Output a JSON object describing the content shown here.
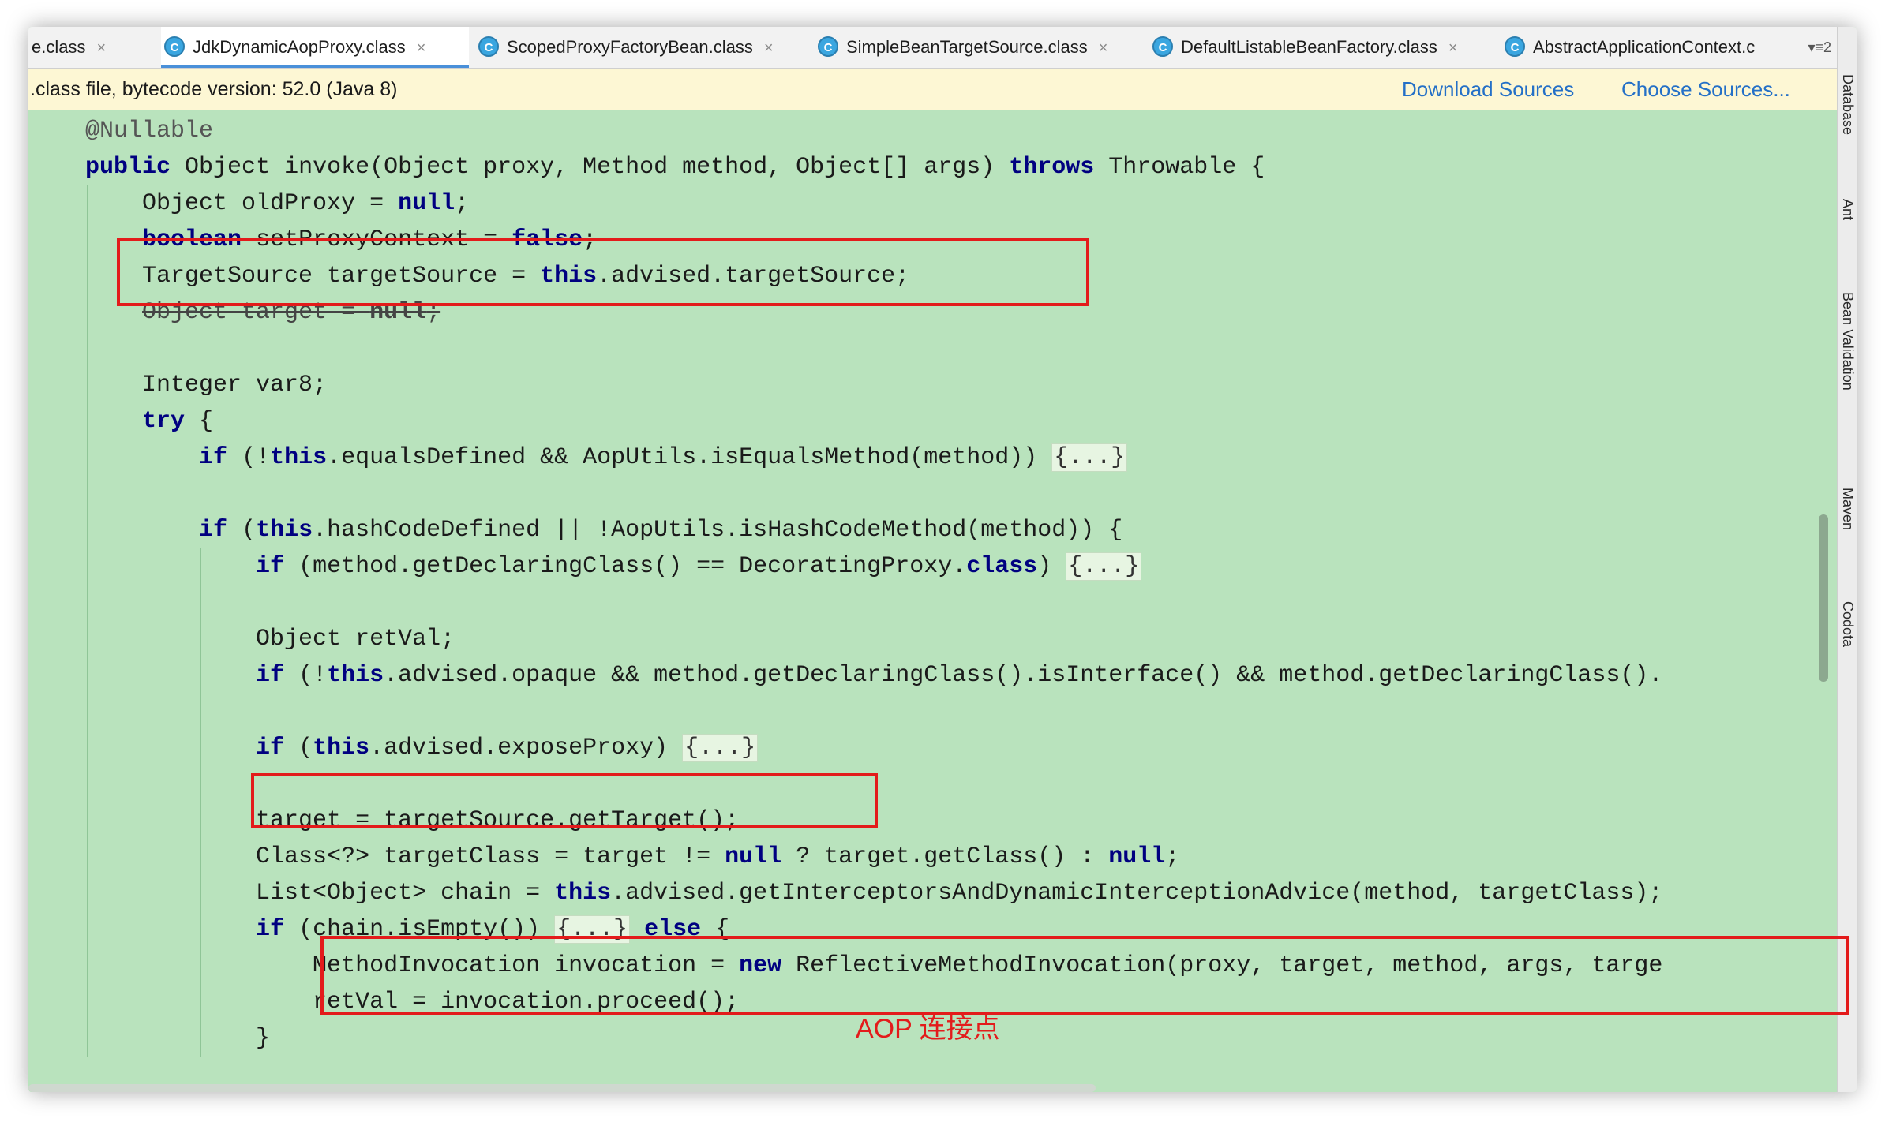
{
  "tabs": [
    {
      "label": "e.class",
      "active": false,
      "icon": false
    },
    {
      "label": "JdkDynamicAopProxy.class",
      "active": true,
      "icon": true
    },
    {
      "label": "ScopedProxyFactoryBean.class",
      "active": false,
      "icon": true
    },
    {
      "label": "SimpleBeanTargetSource.class",
      "active": false,
      "icon": true
    },
    {
      "label": "DefaultListableBeanFactory.class",
      "active": false,
      "icon": true
    },
    {
      "label": "AbstractApplicationContext.c",
      "active": false,
      "icon": true
    }
  ],
  "tab_icon_letter": "C",
  "tab_close_glyph": "×",
  "tab_overflow": "▾≡2",
  "notice": {
    "text": ".class file, bytecode version: 52.0 (Java 8)",
    "download_sources": "Download Sources",
    "choose_sources": "Choose Sources..."
  },
  "tool_windows": [
    "Database",
    "Ant",
    "Bean Validation",
    "Maven",
    "Codota"
  ],
  "code_lines": [
    [
      {
        "t": "    "
      },
      {
        "t": "@Nullable",
        "c": "ann"
      }
    ],
    [
      {
        "t": "    "
      },
      {
        "t": "public",
        "c": "kw"
      },
      {
        "t": " Object invoke(Object proxy, Method method, Object[] args) "
      },
      {
        "t": "throws",
        "c": "kw"
      },
      {
        "t": " Throwable {"
      }
    ],
    [
      {
        "t": "        Object oldProxy = "
      },
      {
        "t": "null",
        "c": "kw"
      },
      {
        "t": ";"
      }
    ],
    [
      {
        "t": "        "
      },
      {
        "t": "boolean",
        "c": "kw"
      },
      {
        "t": " setProxyContext = "
      },
      {
        "t": "false",
        "c": "kw"
      },
      {
        "t": ";"
      }
    ],
    [
      {
        "t": "        TargetSource targetSource = "
      },
      {
        "t": "this",
        "c": "kw"
      },
      {
        "t": ".advised.targetSource;"
      }
    ],
    [
      {
        "t": "        "
      },
      {
        "t": "Object target = ",
        "c": "strike"
      },
      {
        "t": "null",
        "c": "kw strike"
      },
      {
        "t": ";",
        "c": "strike"
      }
    ],
    [],
    [
      {
        "t": "        Integer var8;"
      }
    ],
    [
      {
        "t": "        "
      },
      {
        "t": "try",
        "c": "kw"
      },
      {
        "t": " {"
      }
    ],
    [
      {
        "t": "            "
      },
      {
        "t": "if",
        "c": "kw"
      },
      {
        "t": " (!"
      },
      {
        "t": "this",
        "c": "kw"
      },
      {
        "t": ".equalsDefined && AopUtils.isEqualsMethod(method)) "
      },
      {
        "t": "{...}",
        "c": "fold"
      }
    ],
    [],
    [
      {
        "t": "            "
      },
      {
        "t": "if",
        "c": "kw"
      },
      {
        "t": " ("
      },
      {
        "t": "this",
        "c": "kw"
      },
      {
        "t": ".hashCodeDefined || !AopUtils.isHashCodeMethod(method)) {"
      }
    ],
    [
      {
        "t": "                "
      },
      {
        "t": "if",
        "c": "kw"
      },
      {
        "t": " (method.getDeclaringClass() == DecoratingProxy."
      },
      {
        "t": "class",
        "c": "kw"
      },
      {
        "t": ") "
      },
      {
        "t": "{...}",
        "c": "fold"
      }
    ],
    [],
    [
      {
        "t": "                Object retVal;"
      }
    ],
    [
      {
        "t": "                "
      },
      {
        "t": "if",
        "c": "kw"
      },
      {
        "t": " (!"
      },
      {
        "t": "this",
        "c": "kw"
      },
      {
        "t": ".advised.opaque && method.getDeclaringClass().isInterface() && method.getDeclaringClass()."
      }
    ],
    [],
    [
      {
        "t": "                "
      },
      {
        "t": "if",
        "c": "kw"
      },
      {
        "t": " ("
      },
      {
        "t": "this",
        "c": "kw"
      },
      {
        "t": ".advised.exposeProxy) "
      },
      {
        "t": "{...}",
        "c": "fold"
      }
    ],
    [],
    [
      {
        "t": "                target = targetSource.getTarget();"
      }
    ],
    [
      {
        "t": "                Class<?> targetClass = target != "
      },
      {
        "t": "null",
        "c": "kw"
      },
      {
        "t": " ? target.getClass() : "
      },
      {
        "t": "null",
        "c": "kw"
      },
      {
        "t": ";"
      }
    ],
    [
      {
        "t": "                List<Object> chain = "
      },
      {
        "t": "this",
        "c": "kw"
      },
      {
        "t": ".advised.getInterceptorsAndDynamicInterceptionAdvice(method, targetClass);"
      }
    ],
    [
      {
        "t": "                "
      },
      {
        "t": "if",
        "c": "kw"
      },
      {
        "t": " (chain.isEmpty()) "
      },
      {
        "t": "{...}",
        "c": "fold"
      },
      {
        "t": " "
      },
      {
        "t": "else",
        "c": "kw"
      },
      {
        "t": " {"
      }
    ],
    [
      {
        "t": "                    MethodInvocation invocation = "
      },
      {
        "t": "new",
        "c": "kw"
      },
      {
        "t": " ReflectiveMethodInvocation(proxy, target, method, args, targe"
      }
    ],
    [
      {
        "t": "                    retVal = invocation.proceed();"
      }
    ],
    [
      {
        "t": "                }"
      }
    ]
  ],
  "annotation_label": "AOP 连接点"
}
